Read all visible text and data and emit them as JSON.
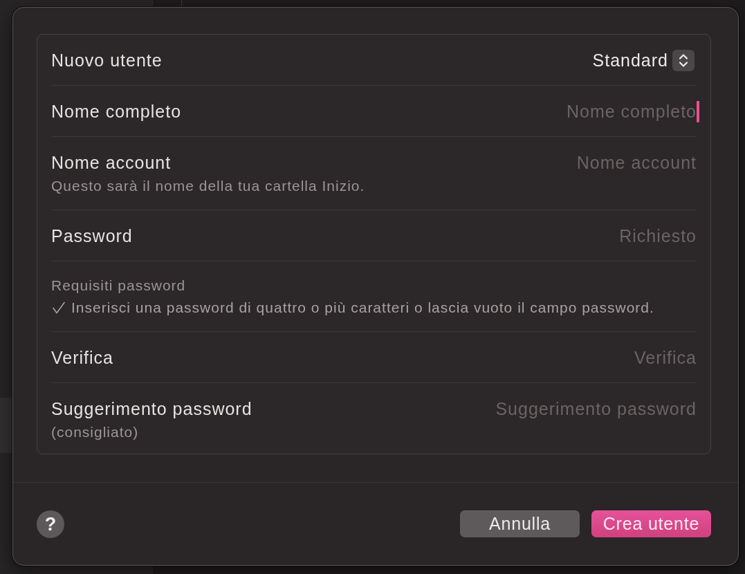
{
  "dialog": {
    "rows": [
      {
        "kind": "popup",
        "label": "Nuovo utente",
        "value": "Standard"
      },
      {
        "kind": "field",
        "label": "Nome completo",
        "placeholder": "Nome completo",
        "focused": true
      },
      {
        "kind": "field",
        "label": "Nome account",
        "note": "Questo sarà il nome della tua cartella Inizio.",
        "placeholder": "Nome account",
        "focused": false
      },
      {
        "kind": "field",
        "label": "Password",
        "placeholder": "Richiesto",
        "focused": false
      },
      {
        "kind": "requirements",
        "label": "Requisiti password",
        "items": [
          {
            "text": "Inserisci una password di quattro o più caratteri o lascia vuoto il campo password.",
            "met": true
          }
        ]
      },
      {
        "kind": "field",
        "label": "Verifica",
        "placeholder": "Verifica",
        "focused": false
      },
      {
        "kind": "field",
        "label": "Suggerimento password",
        "note": "(consigliato)",
        "placeholder": "Suggerimento password",
        "focused": false
      }
    ],
    "help_button": "?",
    "buttons": [
      {
        "label": "Annulla",
        "kind": "cancel"
      },
      {
        "label": "Crea utente",
        "kind": "confirm"
      }
    ]
  }
}
